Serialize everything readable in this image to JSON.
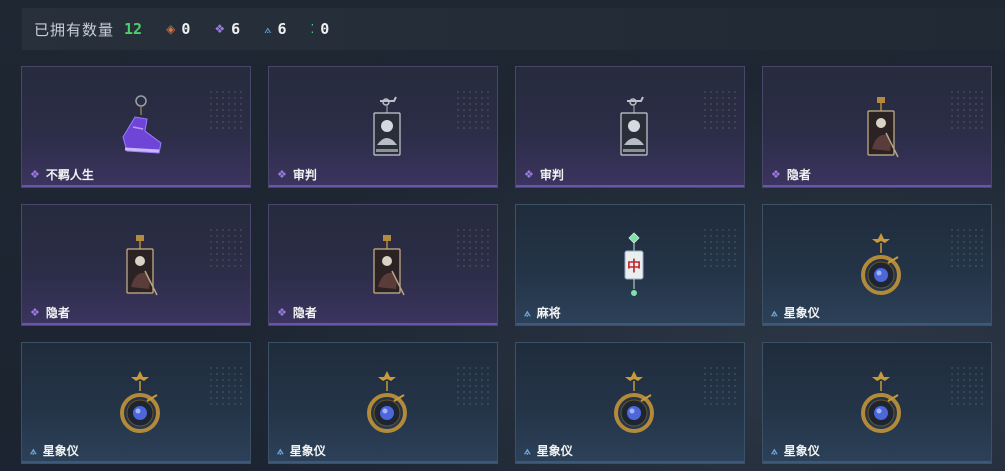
{
  "header": {
    "title": "已拥有数量",
    "total": "12",
    "stats": [
      {
        "glyph": "◈",
        "color": "#d8743e",
        "value": "0",
        "icon": "orange-diamond-icon"
      },
      {
        "glyph": "❖",
        "color": "#9b7be0",
        "value": "6",
        "icon": "purple-diamond-icon"
      },
      {
        "glyph": "⟑",
        "color": "#68a6e0",
        "value": "6",
        "icon": "blue-gem-icon"
      },
      {
        "glyph": "⁚",
        "color": "#44d07a",
        "value": "0",
        "icon": "green-dots-icon"
      }
    ]
  },
  "rarity_icons": {
    "purple": "❖",
    "blue": "⟑"
  },
  "items": [
    {
      "name": "不羁人生",
      "rarity": "purple",
      "kind": "sneaker"
    },
    {
      "name": "审判",
      "rarity": "purple",
      "kind": "card-judge"
    },
    {
      "name": "审判",
      "rarity": "purple",
      "kind": "card-judge"
    },
    {
      "name": "隐者",
      "rarity": "purple",
      "kind": "card-hermit"
    },
    {
      "name": "隐者",
      "rarity": "purple",
      "kind": "card-hermit"
    },
    {
      "name": "隐者",
      "rarity": "purple",
      "kind": "card-hermit"
    },
    {
      "name": "麻将",
      "rarity": "blue",
      "kind": "mahjong"
    },
    {
      "name": "星象仪",
      "rarity": "blue",
      "kind": "astrolabe"
    },
    {
      "name": "星象仪",
      "rarity": "blue",
      "kind": "astrolabe"
    },
    {
      "name": "星象仪",
      "rarity": "blue",
      "kind": "astrolabe"
    },
    {
      "name": "星象仪",
      "rarity": "blue",
      "kind": "astrolabe"
    },
    {
      "name": "星象仪",
      "rarity": "blue",
      "kind": "astrolabe"
    }
  ],
  "mahjong_char": "中"
}
